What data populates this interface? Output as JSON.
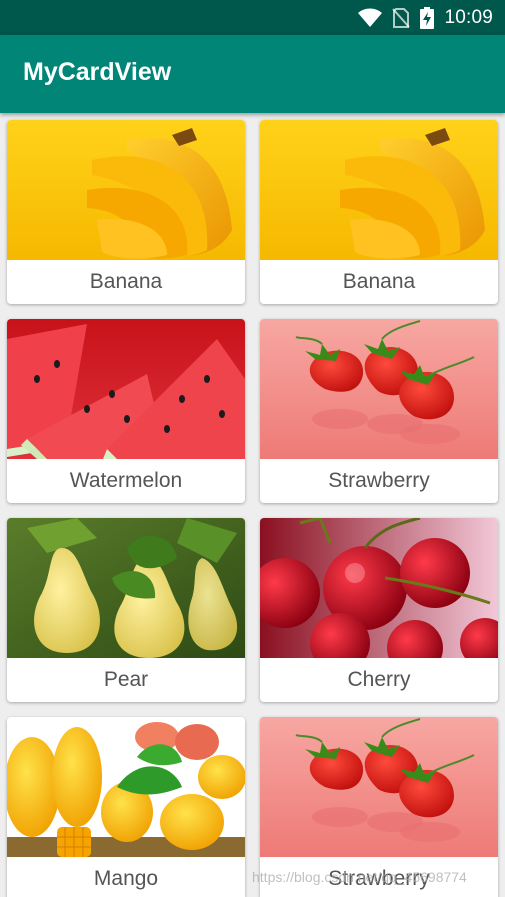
{
  "status_bar": {
    "time": "10:09"
  },
  "toolbar": {
    "title": "MyCardView"
  },
  "cards": [
    {
      "label": "Banana",
      "image": "banana"
    },
    {
      "label": "Banana",
      "image": "banana"
    },
    {
      "label": "Watermelon",
      "image": "watermelon"
    },
    {
      "label": "Strawberry",
      "image": "strawberry"
    },
    {
      "label": "Pear",
      "image": "pear"
    },
    {
      "label": "Cherry",
      "image": "cherry"
    },
    {
      "label": "Mango",
      "image": "mango"
    },
    {
      "label": "Strawberry",
      "image": "strawberry"
    }
  ],
  "watermark": "https://blog.csdn.net/qq_45698774",
  "colors": {
    "status_bar": "#00574b",
    "toolbar": "#008577",
    "background": "#eeeeee",
    "card": "#ffffff",
    "label_text": "#555555"
  }
}
